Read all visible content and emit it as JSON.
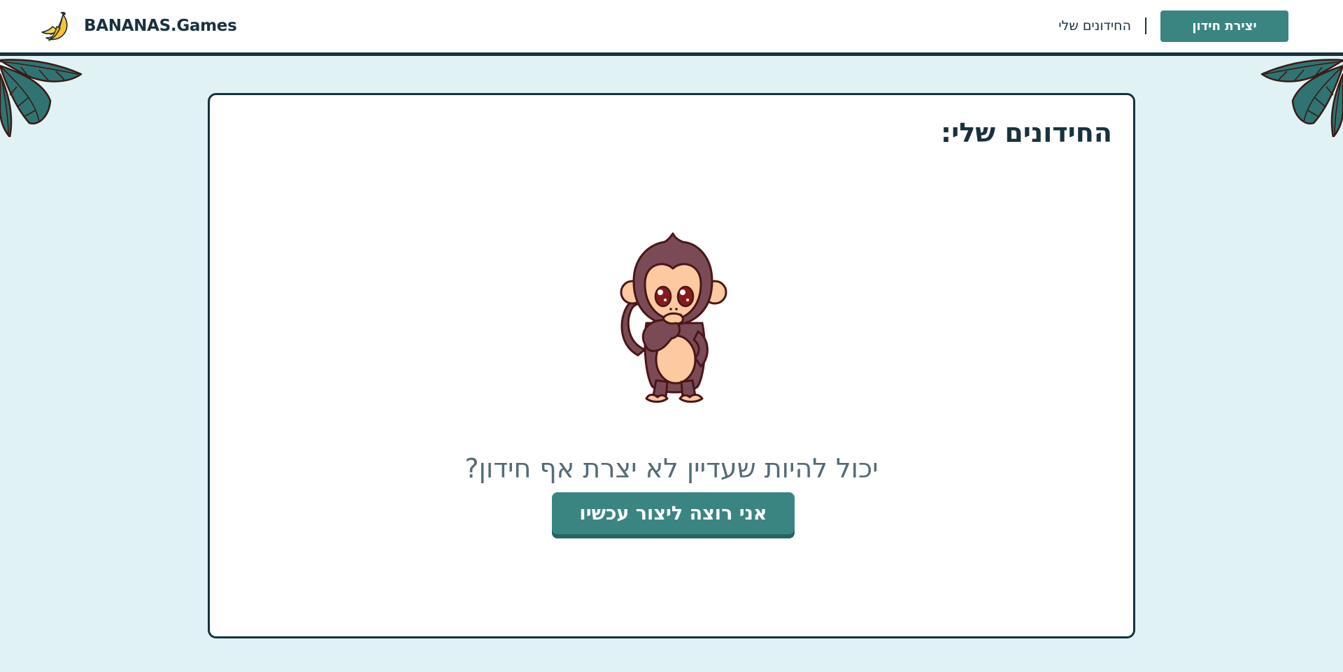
{
  "header": {
    "brand_name": "BANANAS.Games",
    "logo_icon": "banana-icon",
    "nav": {
      "my_riddles_label": "החידונים שלי",
      "create_riddle_label": "יצירת חידון"
    }
  },
  "main": {
    "title": "החידונים שלי:",
    "illustration": "thinking-monkey",
    "empty_message": "יכול להיות שעדיין לא יצרת אף חידון?",
    "cta_label": "אני רוצה ליצור עכשיו"
  },
  "colors": {
    "primary": "#3a8582",
    "dark": "#17323f",
    "background": "#e0f2f4",
    "muted_text": "#546b77"
  }
}
